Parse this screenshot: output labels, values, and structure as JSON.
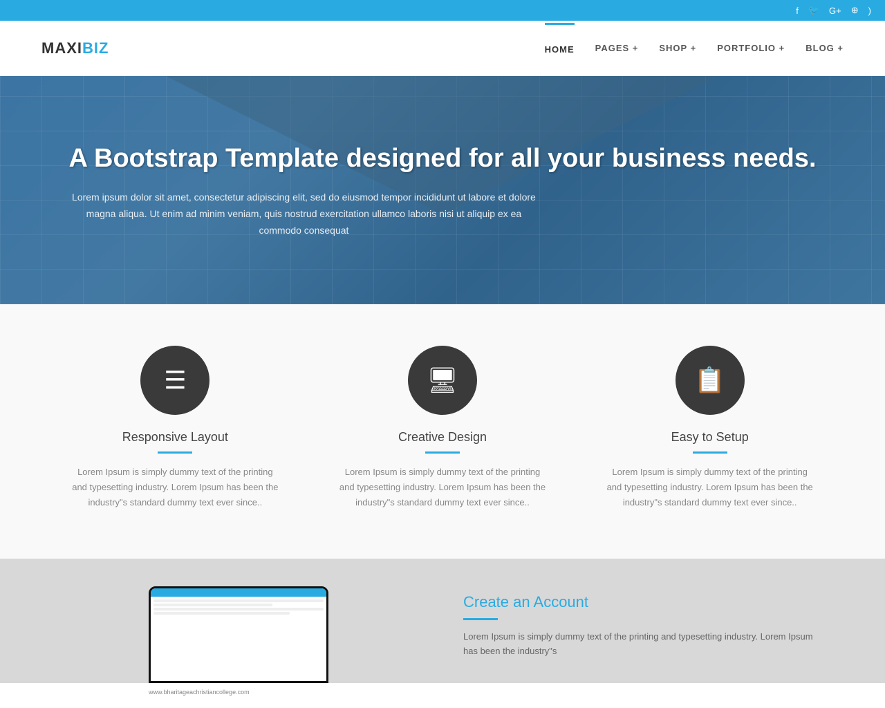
{
  "topbar": {
    "social_icons": [
      "facebook",
      "twitter",
      "google-plus",
      "dribbble",
      "rss"
    ]
  },
  "header": {
    "logo_maxi": "MAXI",
    "logo_biz": "BIZ",
    "nav_items": [
      {
        "label": "HOME",
        "active": true
      },
      {
        "label": "PAGES +",
        "active": false
      },
      {
        "label": "SHOP +",
        "active": false
      },
      {
        "label": "PORTFOLIO +",
        "active": false
      },
      {
        "label": "BLOG +",
        "active": false
      }
    ]
  },
  "hero": {
    "title": "A Bootstrap Template designed for all your business needs.",
    "description": "Lorem ipsum dolor sit amet, consectetur adipiscing elit, sed do eiusmod tempor incididunt ut labore et dolore magna aliqua. Ut enim ad minim veniam, quis nostrud exercitation ullamco laboris nisi ut aliquip ex ea commodo consequat"
  },
  "features": [
    {
      "icon": "☰",
      "title": "Responsive Layout",
      "description": "Lorem Ipsum is simply dummy text of the printing and typesetting industry. Lorem Ipsum has been the industry\"s standard dummy text ever since.."
    },
    {
      "icon": "💻",
      "title": "Creative Design",
      "description": "Lorem Ipsum is simply dummy text of the printing and typesetting industry. Lorem Ipsum has been the industry\"s standard dummy text ever since.."
    },
    {
      "icon": "📋",
      "title": "Easy to Setup",
      "description": "Lorem Ipsum is simply dummy text of the printing and typesetting industry. Lorem Ipsum has been the industry\"s standard dummy text ever since.."
    }
  ],
  "bottom": {
    "heading": "Create an Account",
    "description": "Lorem Ipsum is simply dummy text of the printing and typesetting industry. Lorem Ipsum has been the industry\"s",
    "url": "www.bharitageachristiancollege.com"
  }
}
